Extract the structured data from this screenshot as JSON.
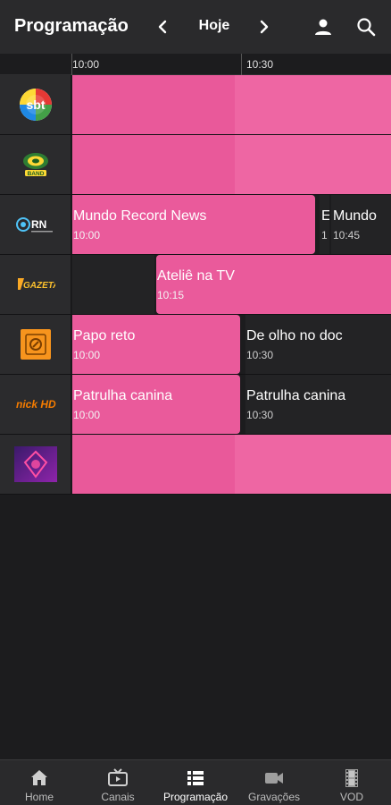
{
  "header": {
    "title": "Programação",
    "date_label": "Hoje",
    "prev_icon": "chevron-left-icon",
    "next_icon": "chevron-right-icon",
    "user_icon": "user-icon",
    "search_icon": "search-icon"
  },
  "ruler": {
    "ticks": [
      "10:00",
      "10:30"
    ]
  },
  "channels": [
    {
      "name": "sbt",
      "logo_text": "sbt",
      "programs": []
    },
    {
      "name": "band",
      "logo_text": "BAND",
      "programs": []
    },
    {
      "name": "record-news",
      "logo_text": "RN",
      "programs": [
        {
          "title": "Mundo Record News",
          "time": "10:00"
        },
        {
          "title": "E",
          "time": "1"
        },
        {
          "title": "Mundo",
          "time": "10:45"
        }
      ]
    },
    {
      "name": "gazeta",
      "logo_text": "GAZETA",
      "programs": [
        {
          "title": "Ateliê na TV",
          "time": "10:15"
        }
      ]
    },
    {
      "name": "futura",
      "logo_text": "",
      "programs": [
        {
          "title": "Papo reto",
          "time": "10:00"
        },
        {
          "title": "De olho no doc",
          "time": "10:30"
        }
      ]
    },
    {
      "name": "nick-hd",
      "logo_text": "nick HD",
      "programs": [
        {
          "title": "Patrulha canina",
          "time": "10:00"
        },
        {
          "title": "Patrulha canina",
          "time": "10:30"
        }
      ]
    },
    {
      "name": "music-channel",
      "logo_text": "",
      "programs": []
    }
  ],
  "bottom_nav": [
    {
      "label": "Home",
      "icon": "home-icon"
    },
    {
      "label": "Canais",
      "icon": "tv-icon"
    },
    {
      "label": "Programação",
      "icon": "guide-list-icon",
      "active": true
    },
    {
      "label": "Gravações",
      "icon": "video-camera-icon"
    },
    {
      "label": "VOD",
      "icon": "film-icon"
    }
  ],
  "colors": {
    "accent": "#ea5a9b",
    "background": "#1c1c1e",
    "bar": "#2a2a2c"
  }
}
